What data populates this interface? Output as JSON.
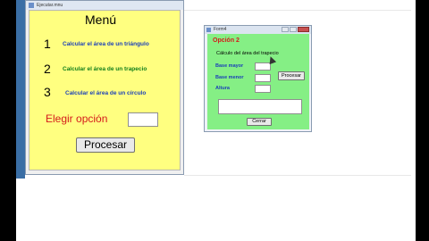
{
  "main_window": {
    "title": "Ejecutar.mnu",
    "menu_title": "Menú",
    "options": [
      {
        "number": "1",
        "label": "Calcular el área de un triángulo"
      },
      {
        "number": "2",
        "label": "Calcular el área de un trapecio"
      },
      {
        "number": "3",
        "label": "Calcular el área de un círculo"
      }
    ],
    "prompt": "Elegir opción",
    "input_value": "",
    "process_button": "Procesar"
  },
  "form_window": {
    "title": "Form4",
    "option_title": "Opción 2",
    "description": "Cálculo del área del trapecio",
    "fields": [
      {
        "label": "Base mayor",
        "value": ""
      },
      {
        "label": "Base menor",
        "value": ""
      },
      {
        "label": "Altura",
        "value": ""
      }
    ],
    "process_button": "Procesar",
    "result_value": "",
    "close_button": "Cerrar"
  },
  "colors": {
    "main_background": "#ffff80",
    "form_background": "#85ef85",
    "option_blue": "#1a3fb8",
    "option_green": "#0f7d1a",
    "accent_red": "#d41b1b"
  }
}
